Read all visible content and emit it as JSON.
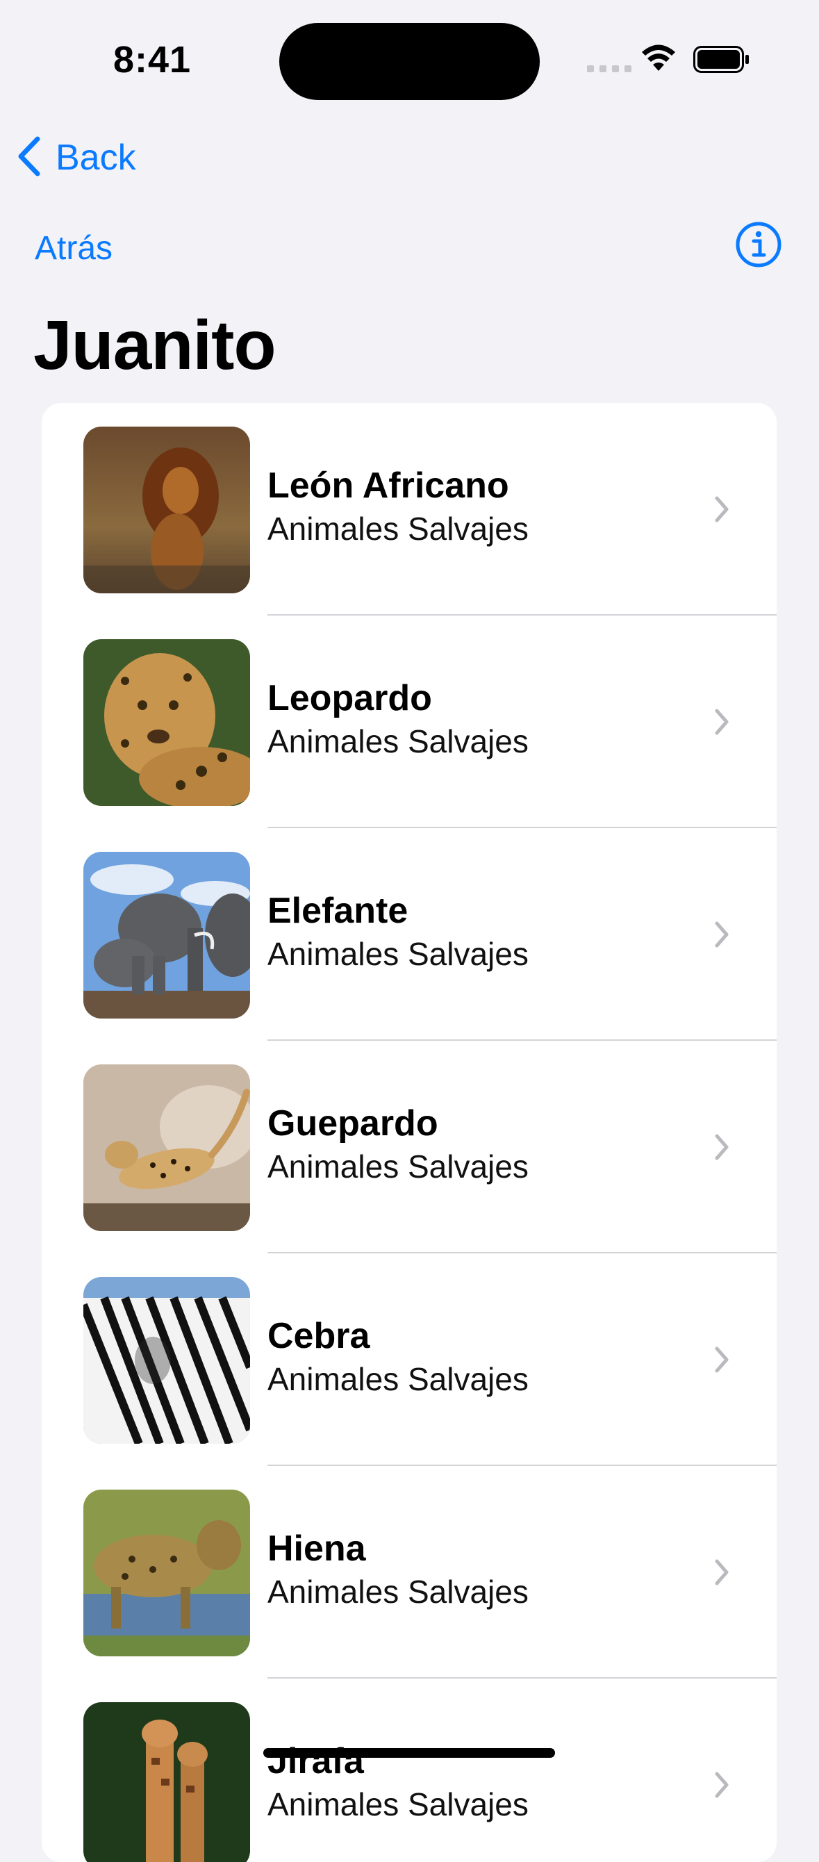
{
  "status_bar": {
    "time": "8:41",
    "signal_icon": "signal-dots-icon",
    "wifi_icon": "wifi-icon",
    "battery_icon": "battery-full-icon"
  },
  "back_nav": {
    "label": "Back",
    "icon": "chevron-left-icon"
  },
  "nav": {
    "back_label": "Atrás",
    "info_icon": "info-circle-icon"
  },
  "page": {
    "title": "Juanito"
  },
  "list": {
    "items": [
      {
        "title": "León Africano",
        "subtitle": "Animales Salvajes"
      },
      {
        "title": "Leopardo",
        "subtitle": "Animales Salvajes"
      },
      {
        "title": "Elefante",
        "subtitle": "Animales Salvajes"
      },
      {
        "title": "Guepardo",
        "subtitle": "Animales Salvajes"
      },
      {
        "title": "Cebra",
        "subtitle": "Animales Salvajes"
      },
      {
        "title": "Hiena",
        "subtitle": "Animales Salvajes"
      },
      {
        "title": "Jirafa",
        "subtitle": "Animales Salvajes"
      }
    ]
  },
  "colors": {
    "accent": "#0a7aff",
    "background": "#f2f2f7",
    "card": "#ffffff",
    "separator": "#d4d4d8",
    "chevron": "#b9b9be"
  }
}
